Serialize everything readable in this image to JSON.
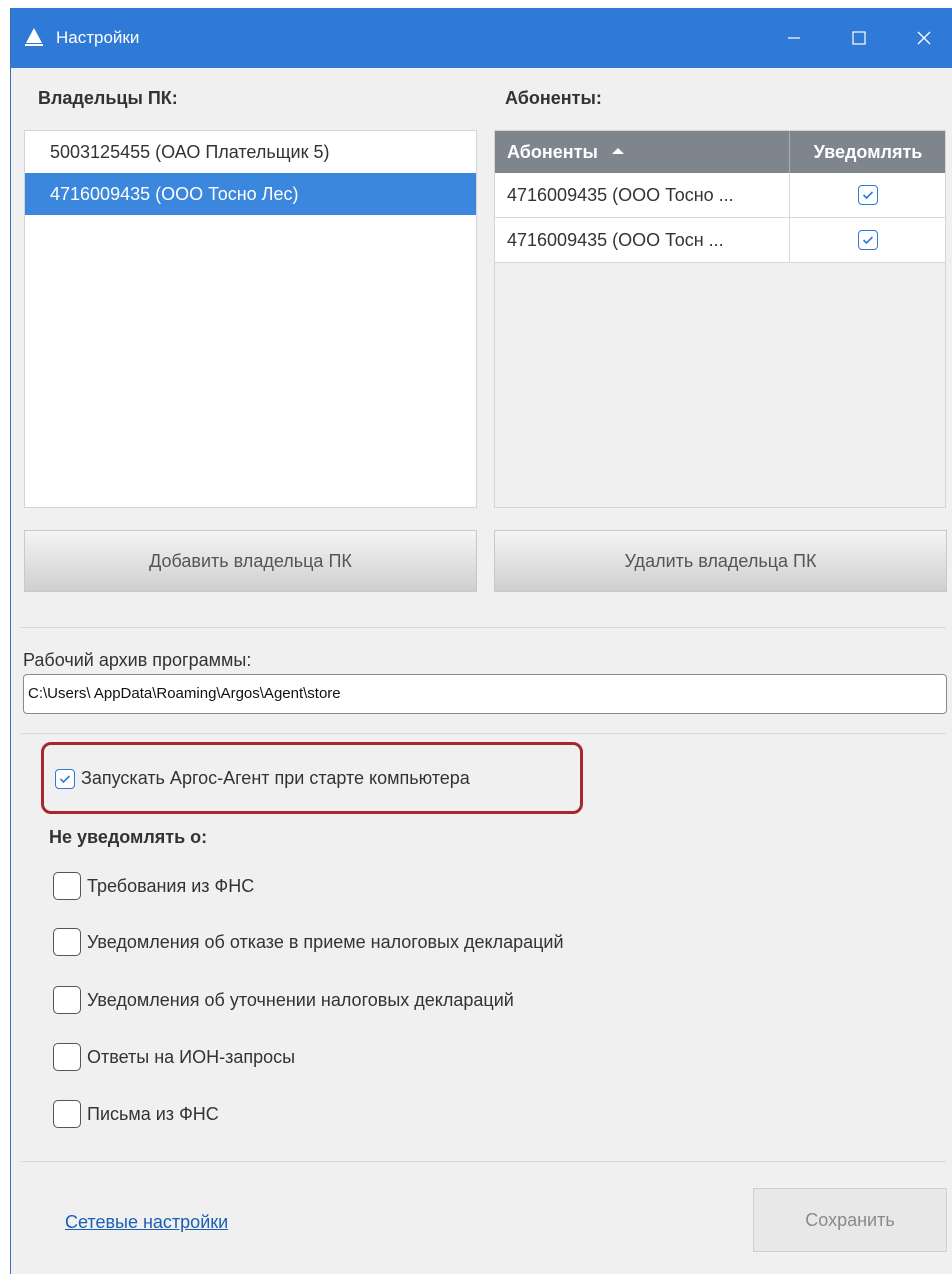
{
  "window": {
    "title": "Настройки"
  },
  "owners": {
    "label": "Владельцы ПК:",
    "items": [
      {
        "label": "5003125455 (ОАО Плательщик 5)",
        "selected": false
      },
      {
        "label": "4716009435 (ООО Тосно Лес)",
        "selected": true
      }
    ]
  },
  "subscribers": {
    "label": "Абоненты:",
    "columns": [
      "Абоненты",
      "Уведомлять"
    ],
    "rows": [
      {
        "name": "4716009435 (ООО Тосно ...",
        "notify": true
      },
      {
        "name": "4716009435 (ООО Тосн ...",
        "notify": true
      }
    ]
  },
  "buttons": {
    "add_owner": "Добавить владельца ПК",
    "remove_owner": "Удалить владельца ПК",
    "save": "Сохранить"
  },
  "archive": {
    "label": "Рабочий архив программы:",
    "path": "C:\\Users\\ AppData\\Roaming\\Argos\\Agent\\store"
  },
  "autostart": {
    "label": "Запускать Аргос-Агент при старте компьютера",
    "checked": true
  },
  "no_notify": {
    "label": "Не уведомлять о:",
    "items": [
      {
        "label": "Требования из ФНС",
        "checked": false
      },
      {
        "label": "Уведомления об отказе в приеме налоговых деклараций",
        "checked": false
      },
      {
        "label": "Уведомления об уточнении налоговых деклараций",
        "checked": false
      },
      {
        "label": "Ответы на ИОН-запросы",
        "checked": false
      },
      {
        "label": "Письма из ФНС",
        "checked": false
      }
    ]
  },
  "network_link": "Сетевые настройки",
  "colors": {
    "titlebar": "#2e7ad6",
    "selection": "#3a87dd",
    "highlight": "#a8262c",
    "link": "#1a5fb4"
  }
}
